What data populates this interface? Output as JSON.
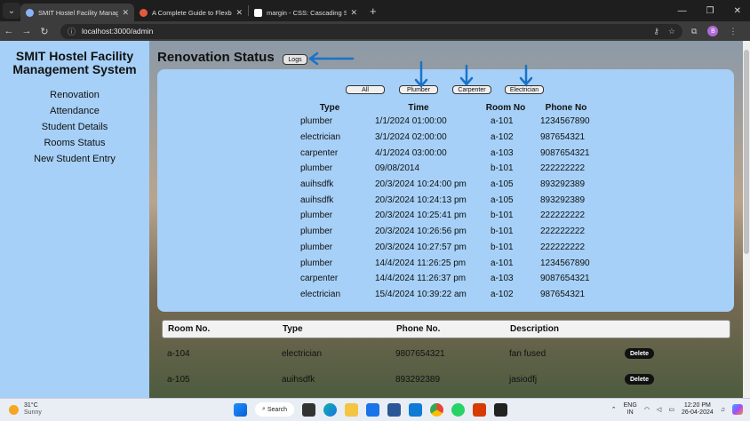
{
  "browser": {
    "tabs": [
      {
        "title": "SMIT Hostel Facility Manageme",
        "active": true,
        "favicon_color": "#8ab4f8"
      },
      {
        "title": "A Complete Guide to Flexbox |",
        "active": false,
        "favicon_color": "#e35b3a"
      },
      {
        "title": "margin - CSS: Cascading Style :",
        "active": false,
        "favicon_color": "#ffffff"
      }
    ],
    "tab_close": "✕",
    "new_tab": "+",
    "url": "localhost:3000/admin",
    "profile_initial": "B"
  },
  "sidebar": {
    "brand": "SMIT Hostel Facility Management System",
    "items": [
      "Renovation",
      "Attendance",
      "Student Details",
      "Rooms Status",
      "New Student Entry"
    ]
  },
  "main": {
    "title": "Renovation Status",
    "logs_label": "Logs",
    "filters": [
      "All",
      "Plumber",
      "Carpenter",
      "Electrician"
    ],
    "log_columns": [
      "Type",
      "Time",
      "Room No",
      "Phone No"
    ],
    "log_rows": [
      [
        "plumber",
        "1/1/2024 01:00:00",
        "a-101",
        "1234567890"
      ],
      [
        "electrician",
        "3/1/2024 02:00:00",
        "a-102",
        "987654321"
      ],
      [
        "carpenter",
        "4/1/2024 03:00:00",
        "a-103",
        "9087654321"
      ],
      [
        "plumber",
        "09/08/2014",
        "b-101",
        "222222222"
      ],
      [
        "auihsdfk",
        "20/3/2024 10:24:00 pm",
        "a-105",
        "893292389"
      ],
      [
        "auihsdfk",
        "20/3/2024 10:24:13 pm",
        "a-105",
        "893292389"
      ],
      [
        "plumber",
        "20/3/2024 10:25:41 pm",
        "b-101",
        "222222222"
      ],
      [
        "plumber",
        "20/3/2024 10:26:56 pm",
        "b-101",
        "222222222"
      ],
      [
        "plumber",
        "20/3/2024 10:27:57 pm",
        "b-101",
        "222222222"
      ],
      [
        "plumber",
        "14/4/2024 11:26:25 pm",
        "a-101",
        "1234567890"
      ],
      [
        "carpenter",
        "14/4/2024 11:26:37 pm",
        "a-103",
        "9087654321"
      ],
      [
        "electrician",
        "15/4/2024 10:39:22 am",
        "a-102",
        "987654321"
      ]
    ],
    "rooms_columns": [
      "Room No.",
      "Type",
      "Phone No.",
      "Description"
    ],
    "rooms_rows": [
      [
        "a-104",
        "electrician",
        "9807654321",
        "fan fused"
      ],
      [
        "a-105",
        "auihsdfk",
        "893292389",
        "jasiodfj"
      ]
    ],
    "delete_label": "Delete",
    "arrow_color": "#1a73c9"
  },
  "taskbar": {
    "temperature": "31°C",
    "condition": "Sunny",
    "search_label": "Search",
    "language_top": "ENG",
    "language_bottom": "IN",
    "time": "12:20 PM",
    "date": "26-04-2024"
  }
}
